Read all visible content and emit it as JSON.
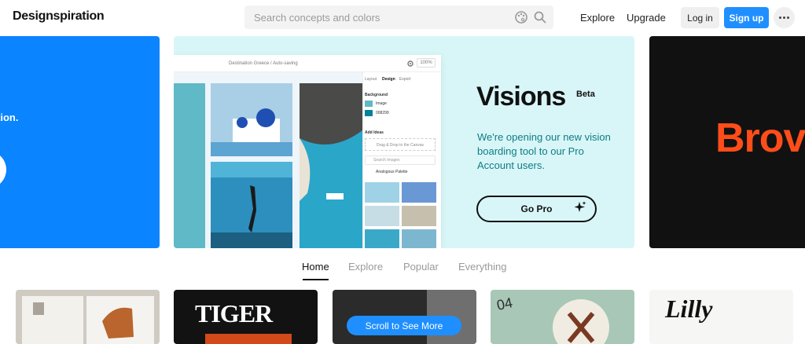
{
  "header": {
    "logo": "Designspiration",
    "search_placeholder": "Search concepts and colors",
    "nav": [
      "Explore",
      "Upgrade"
    ],
    "login": "Log in",
    "signup": "Sign up"
  },
  "banners": {
    "left_text": "tion.",
    "center": {
      "mock_breadcrumb": "Destination Greece / Auto-saving",
      "zoom": "100%",
      "panel_tabs": [
        "Layout",
        "Design",
        "Export"
      ],
      "panel_background": "Background",
      "panel_image": "Image",
      "panel_color": "008299",
      "panel_add_ideas": "Add Ideas",
      "panel_drag": "Drag & Drop to the Canvas",
      "panel_search": "Search Images",
      "panel_palette": "Analogous Palette",
      "title": "Visions",
      "beta": "Beta",
      "description": "We're opening our new vision boarding tool to our Pro Account users.",
      "cta": "Go Pro"
    },
    "right_text": "Brov"
  },
  "tabs": {
    "items": [
      "Home",
      "Explore",
      "Popular",
      "Everything"
    ],
    "active": "Home"
  },
  "thumbnails": {
    "tiger": "TIGER",
    "lilly": "Lilly",
    "badge": "04"
  },
  "scroll_prompt": "Scroll to See More",
  "colors": {
    "accent": "#1f8fff",
    "teal_text": "#0f7c86",
    "banner_center_bg": "#d8f6f7",
    "banner_left_bg": "#0a84ff",
    "banner_right_bg": "#111111"
  }
}
